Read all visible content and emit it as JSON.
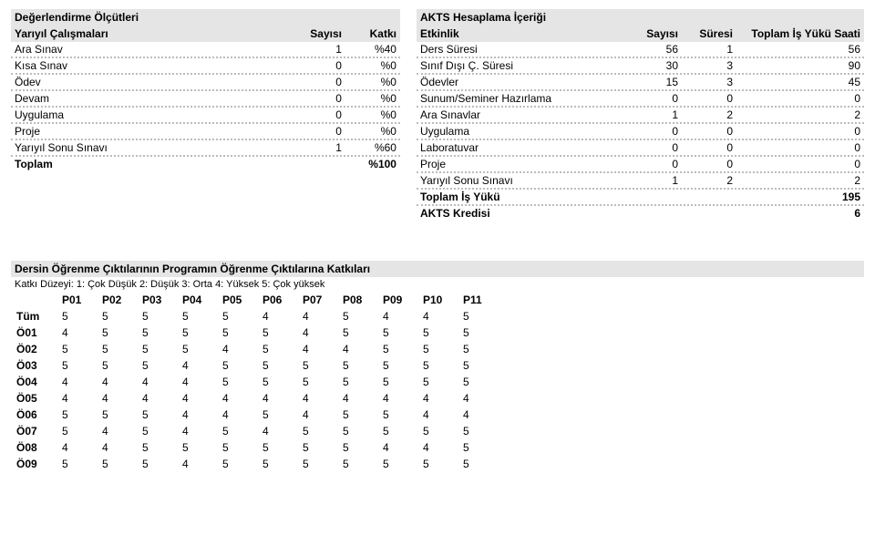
{
  "left": {
    "title": "Değerlendirme Ölçütleri",
    "h_label": "Yarıyıl Çalışmaları",
    "h_col2": "Sayısı",
    "h_col3": "Katkı",
    "rows": [
      {
        "label": "Ara Sınav",
        "n": "1",
        "p": "%40"
      },
      {
        "label": "Kısa Sınav",
        "n": "0",
        "p": "%0"
      },
      {
        "label": "Ödev",
        "n": "0",
        "p": "%0"
      },
      {
        "label": "Devam",
        "n": "0",
        "p": "%0"
      },
      {
        "label": "Uygulama",
        "n": "0",
        "p": "%0"
      },
      {
        "label": "Proje",
        "n": "0",
        "p": "%0"
      },
      {
        "label": "Yarıyıl Sonu Sınavı",
        "n": "1",
        "p": "%60"
      }
    ],
    "total_label": "Toplam",
    "total_val": "%100"
  },
  "right": {
    "title": "AKTS Hesaplama İçeriği",
    "h_label": "Etkinlik",
    "h_c2": "Sayısı",
    "h_c3": "Süresi",
    "h_c4": "Toplam İş Yükü Saati",
    "rows": [
      {
        "label": "Ders Süresi",
        "a": "56",
        "b": "1",
        "c": "56"
      },
      {
        "label": "Sınıf Dışı Ç. Süresi",
        "a": "30",
        "b": "3",
        "c": "90"
      },
      {
        "label": "Ödevler",
        "a": "15",
        "b": "3",
        "c": "45"
      },
      {
        "label": "Sunum/Seminer Hazırlama",
        "a": "0",
        "b": "0",
        "c": "0"
      },
      {
        "label": "Ara Sınavlar",
        "a": "1",
        "b": "2",
        "c": "2"
      },
      {
        "label": "Uygulama",
        "a": "0",
        "b": "0",
        "c": "0"
      },
      {
        "label": "Laboratuvar",
        "a": "0",
        "b": "0",
        "c": "0"
      },
      {
        "label": "Proje",
        "a": "0",
        "b": "0",
        "c": "0"
      },
      {
        "label": "Yarıyıl Sonu Sınavı",
        "a": "1",
        "b": "2",
        "c": "2"
      }
    ],
    "tot1_label": "Toplam İş Yükü",
    "tot1_val": "195",
    "tot2_label": "AKTS Kredisi",
    "tot2_val": "6"
  },
  "matrix": {
    "title": "Dersin Öğrenme Çıktılarının Programın Öğrenme Çıktılarına Katkıları",
    "note": "Katkı Düzeyi: 1: Çok Düşük 2: Düşük 3: Orta 4: Yüksek 5: Çok yüksek",
    "cols": [
      "P01",
      "P02",
      "P03",
      "P04",
      "P05",
      "P06",
      "P07",
      "P08",
      "P09",
      "P10",
      "P11"
    ],
    "rows": [
      {
        "label": "Tüm",
        "v": [
          "5",
          "5",
          "5",
          "5",
          "5",
          "4",
          "4",
          "5",
          "4",
          "4",
          "5"
        ]
      },
      {
        "label": "Ö01",
        "v": [
          "4",
          "5",
          "5",
          "5",
          "5",
          "5",
          "4",
          "5",
          "5",
          "5",
          "5"
        ]
      },
      {
        "label": "Ö02",
        "v": [
          "5",
          "5",
          "5",
          "5",
          "4",
          "5",
          "4",
          "4",
          "5",
          "5",
          "5"
        ]
      },
      {
        "label": "Ö03",
        "v": [
          "5",
          "5",
          "5",
          "4",
          "5",
          "5",
          "5",
          "5",
          "5",
          "5",
          "5"
        ]
      },
      {
        "label": "Ö04",
        "v": [
          "4",
          "4",
          "4",
          "4",
          "5",
          "5",
          "5",
          "5",
          "5",
          "5",
          "5"
        ]
      },
      {
        "label": "Ö05",
        "v": [
          "4",
          "4",
          "4",
          "4",
          "4",
          "4",
          "4",
          "4",
          "4",
          "4",
          "4"
        ]
      },
      {
        "label": "Ö06",
        "v": [
          "5",
          "5",
          "5",
          "4",
          "4",
          "5",
          "4",
          "5",
          "5",
          "4",
          "4"
        ]
      },
      {
        "label": "Ö07",
        "v": [
          "5",
          "4",
          "5",
          "4",
          "5",
          "4",
          "5",
          "5",
          "5",
          "5",
          "5"
        ]
      },
      {
        "label": "Ö08",
        "v": [
          "4",
          "4",
          "5",
          "5",
          "5",
          "5",
          "5",
          "5",
          "4",
          "4",
          "5"
        ]
      },
      {
        "label": "Ö09",
        "v": [
          "5",
          "5",
          "5",
          "4",
          "5",
          "5",
          "5",
          "5",
          "5",
          "5",
          "5"
        ]
      }
    ]
  }
}
